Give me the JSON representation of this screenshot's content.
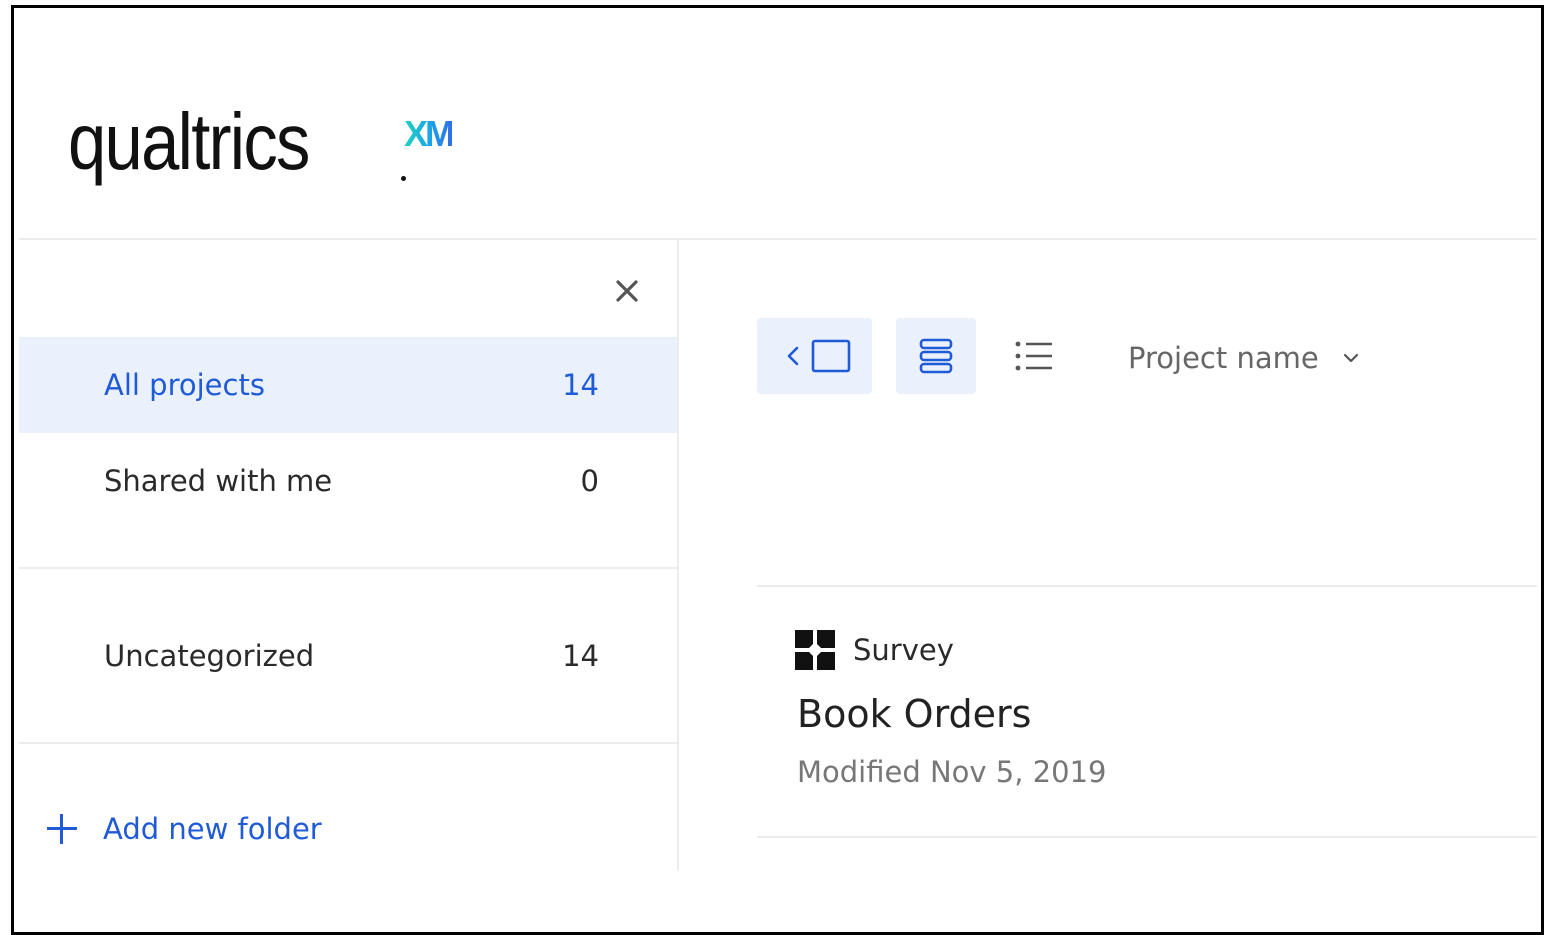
{
  "brand": {
    "name": "qualtrics",
    "suffix": "XM"
  },
  "sidebar": {
    "close_icon": "close-icon",
    "items": [
      {
        "label": "All projects",
        "count": "14",
        "active": true
      },
      {
        "label": "Shared with me",
        "count": "0",
        "active": false
      },
      {
        "label": "Uncategorized",
        "count": "14",
        "active": false
      }
    ],
    "add_folder_label": "Add new folder"
  },
  "toolbar": {
    "collapse_icon": "chevron-left-panel-icon",
    "card_view_icon": "stacked-rows-icon",
    "list_view_icon": "list-icon",
    "sort_label": "Project name",
    "sort_icon": "chevron-down-icon"
  },
  "projects": [
    {
      "type": "Survey",
      "title": "Book Orders",
      "modified": "Modified Nov 5, 2019"
    }
  ],
  "colors": {
    "accent": "#1f5bd6",
    "active_bg": "#eaf1fc",
    "divider": "#ececec",
    "muted_text": "#777777"
  }
}
